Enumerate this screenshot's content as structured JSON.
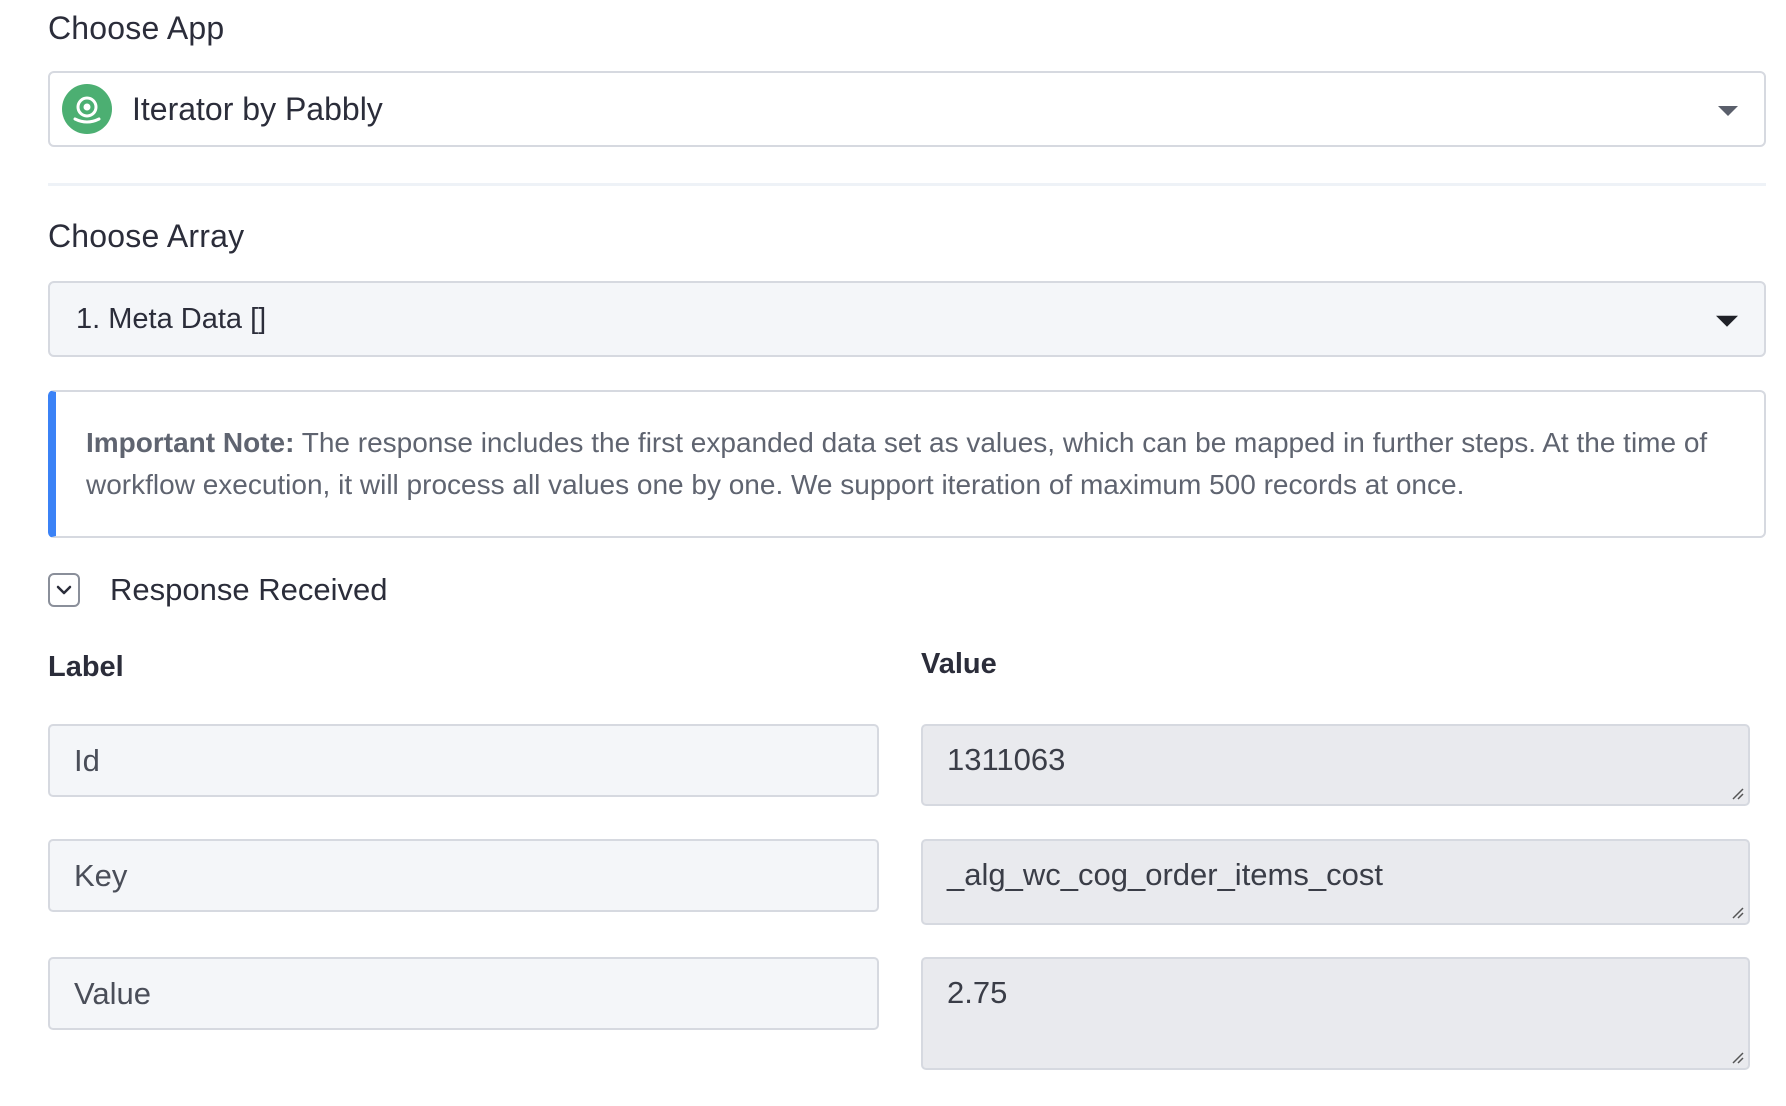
{
  "choose_app": {
    "label": "Choose App",
    "selected": "Iterator by Pabbly",
    "icon": "iterator-app-icon",
    "icon_color": "#4caf72"
  },
  "choose_array": {
    "label": "Choose Array",
    "selected": "1. Meta Data []"
  },
  "note": {
    "title": "Important Note:",
    "body": " The response includes the first expanded data set as values, which can be mapped in further steps. At the time of workflow execution, it will process all values one by one. We support iteration of maximum 500 records at once.",
    "accent_color": "#3b82f6"
  },
  "response": {
    "toggle_label": "Response Received",
    "label_header": "Label",
    "value_header": "Value",
    "rows": [
      {
        "label": "Id",
        "value": "1311063"
      },
      {
        "label": "Key",
        "value": "_alg_wc_cog_order_items_cost"
      },
      {
        "label": "Value",
        "value": "2.75"
      }
    ]
  }
}
